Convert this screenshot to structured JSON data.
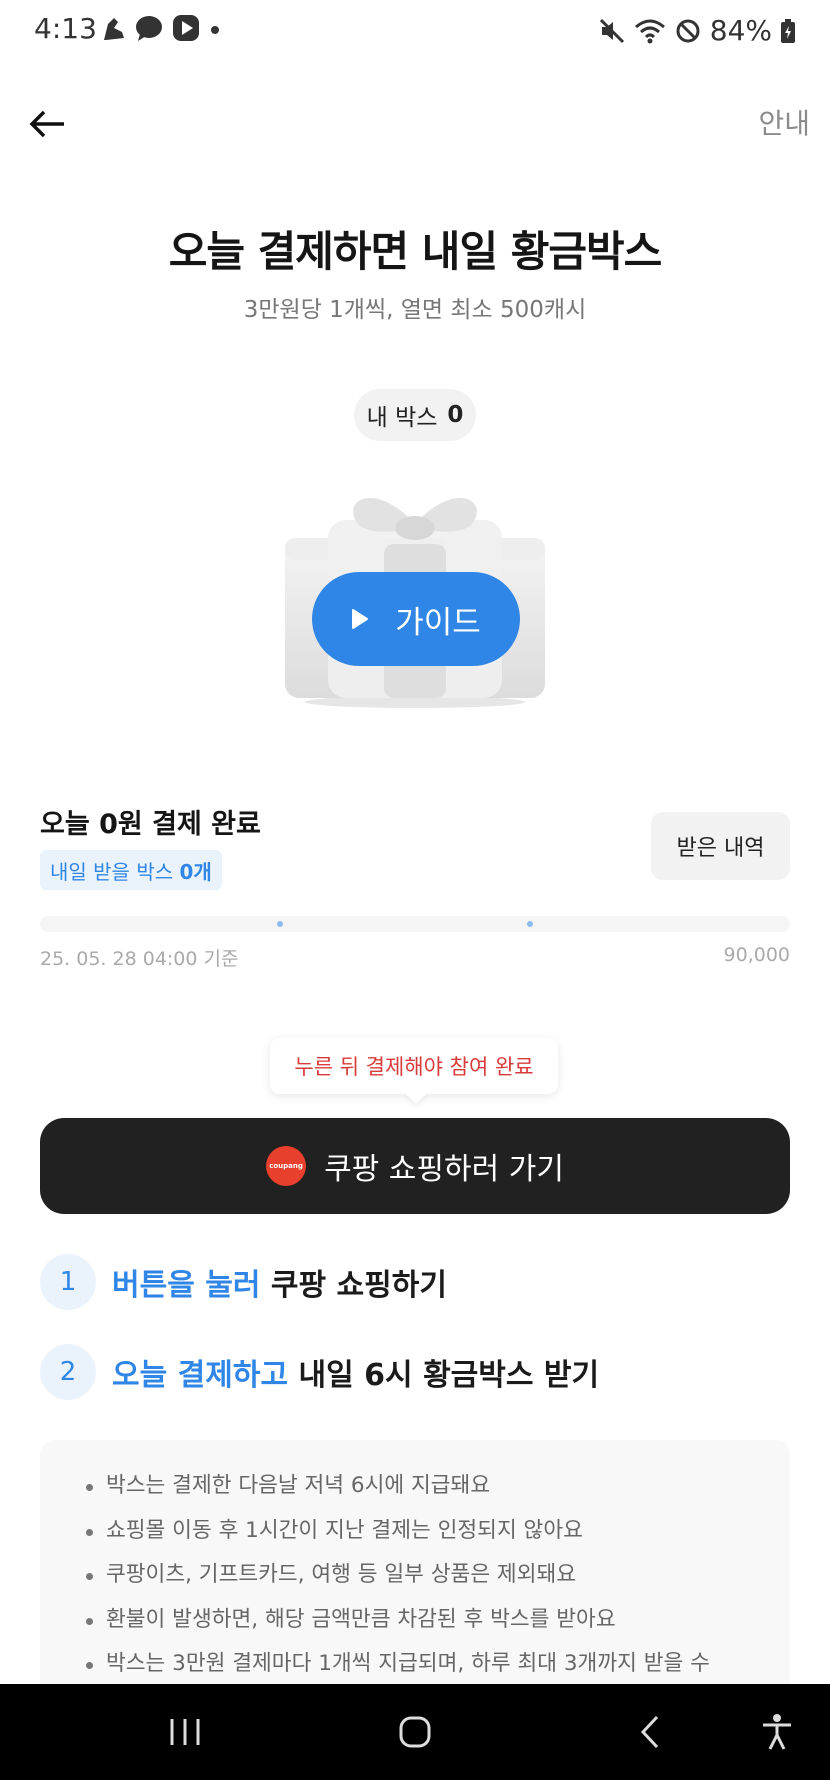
{
  "status_bar": {
    "time": "4:13",
    "battery": "84%",
    "left_icons": [
      "shoe-icon",
      "chat-icon",
      "play-icon",
      "dot-icon"
    ],
    "right_icons": [
      "mute-icon",
      "wifi-icon",
      "block-icon",
      "battery-icon"
    ]
  },
  "header": {
    "info_label": "안내"
  },
  "hero": {
    "title": "오늘 결제하면 내일 황금박스",
    "subtitle": "3만원당 1개씩, 열면 최소 500캐시",
    "my_box_label": "내 박스",
    "my_box_count": "0",
    "guide_label": "가이드"
  },
  "payment": {
    "title": "오늘 0원 결제 완료",
    "badge_prefix": "내일 받을 박스",
    "badge_count": "0개",
    "history_label": "받은 내역",
    "progress_date": "25. 05. 28 04:00 기준",
    "progress_max": "90,000",
    "progress_fraction": 0
  },
  "cta": {
    "tooltip": "누른 뒤 결제해야 참여 완료",
    "logo_text": "coupang",
    "label": "쿠팡 쇼핑하러 가기"
  },
  "steps": [
    {
      "num": "1",
      "highlight": "버튼을 눌러",
      "rest": "쿠팡 쇼핑하기"
    },
    {
      "num": "2",
      "highlight": "오늘 결제하고",
      "rest": "내일 6시 황금박스 받기"
    }
  ],
  "notes": [
    "박스는 결제한 다음날 저녁 6시에 지급돼요",
    "쇼핑몰 이동 후 1시간이 지난 결제는 인정되지 않아요",
    "쿠팡이츠, 기프트카드, 여행 등 일부 상품은 제외돼요",
    "환불이 발생하면, 해당 금액만큼 차감된 후 박스를 받아요",
    "박스는 3만원 결제마다 1개씩 지급되며, 하루 최대 3개까지 받을 수"
  ],
  "nav_bar": {
    "items": [
      "recent-apps-icon",
      "home-icon",
      "back-icon",
      "accessibility-icon"
    ]
  },
  "colors": {
    "accent": "#2f86e6",
    "cta_bg": "#212121",
    "tooltip_text": "#d93a3a",
    "coupang_red": "#e8402c"
  }
}
